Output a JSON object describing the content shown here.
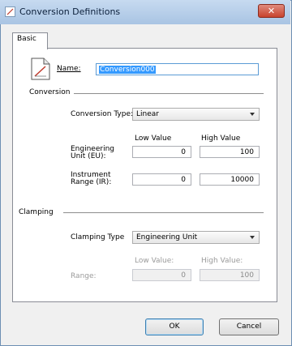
{
  "window": {
    "title": "Conversion Definitions",
    "close_glyph": "✕"
  },
  "tab": {
    "label": "Basic"
  },
  "name": {
    "label": "Name:",
    "value": "Conversion000"
  },
  "conversion": {
    "section_label": "Conversion",
    "type_label": "Conversion Type:",
    "type_value": "Linear",
    "low_header": "Low Value",
    "high_header": "High Value",
    "eu_label_line1": "Engineering",
    "eu_label_line2": "Unit (EU):",
    "eu_low": "0",
    "eu_high": "100",
    "ir_label_line1": "Instrument",
    "ir_label_line2": "Range (IR):",
    "ir_low": "0",
    "ir_high": "10000"
  },
  "clamping": {
    "section_label": "Clamping",
    "type_label": "Clamping Type",
    "type_value": "Engineering Unit",
    "low_header": "Low Value:",
    "high_header": "High Value:",
    "range_label": "Range:",
    "range_low": "0",
    "range_high": "100"
  },
  "buttons": {
    "ok": "OK",
    "cancel": "Cancel"
  }
}
